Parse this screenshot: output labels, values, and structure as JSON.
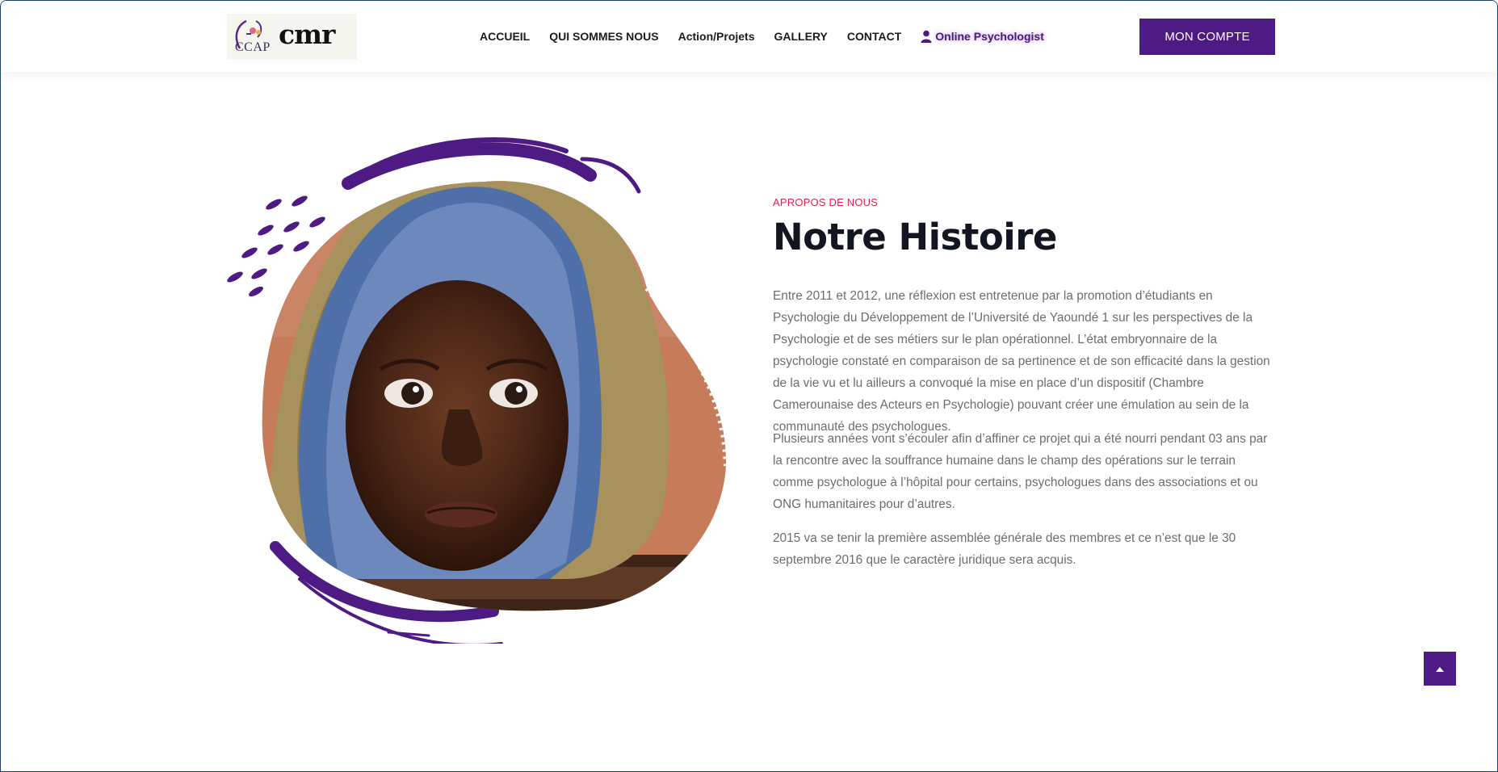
{
  "brand": {
    "logo_text": "cmr",
    "logo_mark_text": "CCAP"
  },
  "nav": {
    "items": [
      {
        "label": "ACCUEIL"
      },
      {
        "label": "QUI SOMMES NOUS"
      },
      {
        "label": "Action/Projets"
      },
      {
        "label": "GALLERY"
      },
      {
        "label": "CONTACT"
      }
    ],
    "online_label": "Online Psychologist",
    "account_button": "MON COMPTE"
  },
  "about": {
    "eyebrow": "APROPOS DE NOUS",
    "title": "Notre Histoire",
    "paragraphs": [
      "Entre 2011 et 2012, une réflexion est entretenue par la promotion d’étudiants en Psychologie du Développement de l’Université de Yaoundé 1 sur les perspectives de la Psychologie et de ses métiers sur le plan opérationnel. L’état embryonnaire de la psychologie constaté en comparaison de sa pertinence et de son efficacité dans la gestion de la vie vu et lu ailleurs a convoqué la mise en place d’un dispositif (Chambre Camerounaise des Acteurs en Psychologie) pouvant créer une émulation au sein de la communauté des psychologues.",
      "Plusieurs années vont s’écouler afin d’affiner ce projet qui a été nourri pendant 03 ans par la rencontre avec la souffrance humaine dans le champ des opérations sur le terrain comme psychologue à l’hôpital pour certains, psychologues dans des associations et ou ONG humanitaires pour d’autres.",
      "2015 va se tenir la première assemblée générale des membres et ce n’est que le 30 septembre 2016 que le caractère juridique sera acquis."
    ]
  },
  "colors": {
    "brand_purple": "#4e1a83",
    "accent_red": "#e0214d",
    "heading": "#121621",
    "body_text": "#6d6d6d"
  },
  "icons": {
    "online": "person-icon",
    "back_to_top": "arrow-up-icon"
  }
}
